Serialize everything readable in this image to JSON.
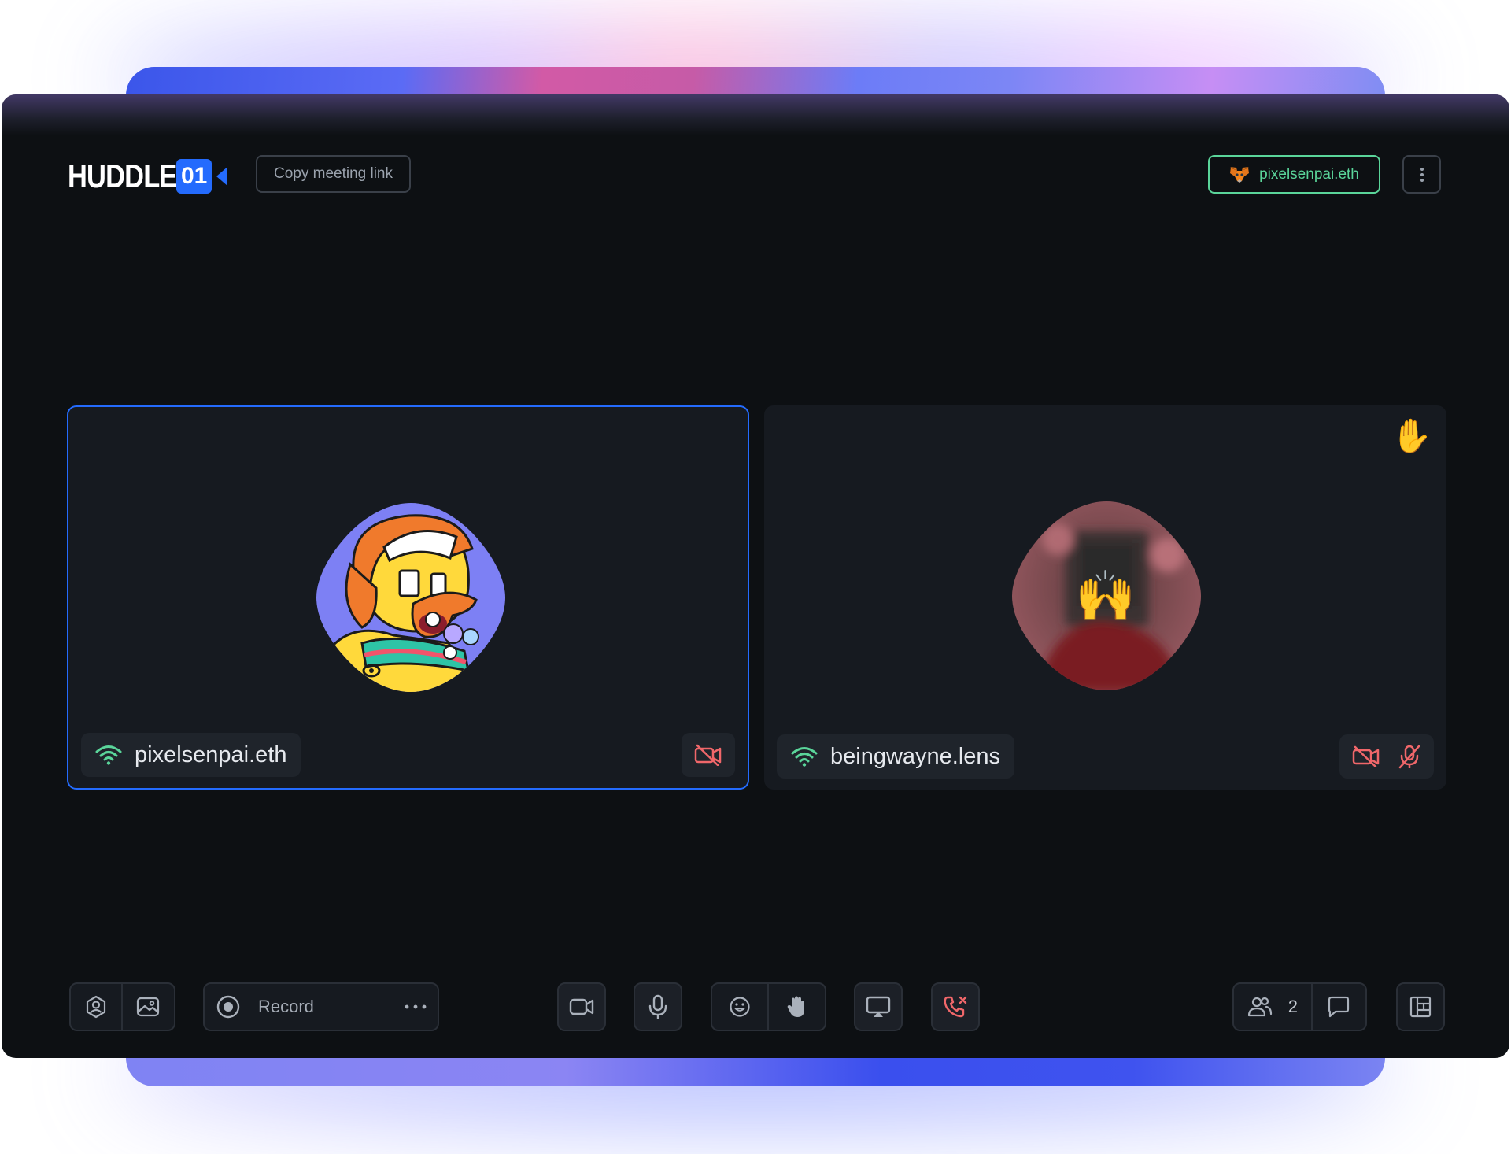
{
  "header": {
    "logo_word": "HUDDLE",
    "logo_num": "01",
    "copy_link_label": "Copy meeting link",
    "wallet_name": "pixelsenpai.eth"
  },
  "tiles": [
    {
      "name": "pixelsenpai.eth",
      "video_off": true,
      "mic_off": false,
      "active_speaker": true,
      "hand_raised": false
    },
    {
      "name": "beingwayne.lens",
      "video_off": true,
      "mic_off": true,
      "active_speaker": false,
      "hand_raised": true,
      "hand_emoji": "✋",
      "avatar_emoji": "🙌"
    }
  ],
  "toolbar": {
    "record_label": "Record",
    "participant_count": "2"
  },
  "colors": {
    "accent": "#246bfd",
    "success": "#5ad59a",
    "danger": "#f0676a",
    "background": "#0d1013",
    "tile": "#161a20"
  },
  "icons": [
    "avatar-settings-icon",
    "image-icon",
    "record-icon",
    "more-horizontal-icon",
    "video-camera-icon",
    "microphone-icon",
    "emoji-icon",
    "hand-icon",
    "screen-share-icon",
    "end-call-icon",
    "participants-icon",
    "chat-icon",
    "layout-icon"
  ]
}
